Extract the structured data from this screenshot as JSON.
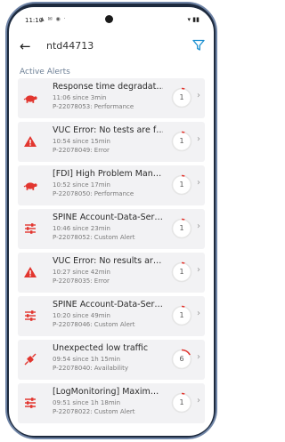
{
  "status": {
    "time": "11:10",
    "icons": "▲ ✉ ◉ ·",
    "right": "▾ ▮▮"
  },
  "appbar": {
    "title": "ntd44713"
  },
  "section_title": "Active Alerts",
  "colors": {
    "alert_red": "#e2362f",
    "card_bg": "#f2f2f4",
    "accent": "#1b8fd0"
  },
  "alerts": [
    {
      "icon": "turtle-icon",
      "title": "Response time degradat…",
      "time": "11:06 since 3min",
      "id_type": "P-22078053: Performance",
      "count": "1",
      "progress": 0.05
    },
    {
      "icon": "warning-triangle-icon",
      "title": "VUC Error: No tests are f…",
      "time": "10:54 since 15min",
      "id_type": "P-22078049: Error",
      "count": "1",
      "progress": 0.05
    },
    {
      "icon": "turtle-icon",
      "title": "[FDI] High Problem Man…",
      "time": "10:52 since 17min",
      "id_type": "P-22078050: Performance",
      "count": "1",
      "progress": 0.05
    },
    {
      "icon": "sliders-icon",
      "title": "SPINE Account-Data-Ser…",
      "time": "10:46 since 23min",
      "id_type": "P-22078052: Custom Alert",
      "count": "1",
      "progress": 0.05
    },
    {
      "icon": "warning-triangle-icon",
      "title": "VUC Error: No results ar…",
      "time": "10:27 since 42min",
      "id_type": "P-22078035: Error",
      "count": "1",
      "progress": 0.05
    },
    {
      "icon": "sliders-icon",
      "title": "SPINE Account-Data-Ser…",
      "time": "10:20 since 49min",
      "id_type": "P-22078046: Custom Alert",
      "count": "1",
      "progress": 0.05
    },
    {
      "icon": "plug-icon",
      "title": "Unexpected low traffic",
      "time": "09:54 since 1h 15min",
      "id_type": "P-22078040: Availability",
      "count": "6",
      "progress": 0.17
    },
    {
      "icon": "sliders-icon",
      "title": "[LogMonitoring] Maxim…",
      "time": "09:51 since 1h 18min",
      "id_type": "P-22078022: Custom Alert",
      "count": "1",
      "progress": 0.05
    }
  ]
}
